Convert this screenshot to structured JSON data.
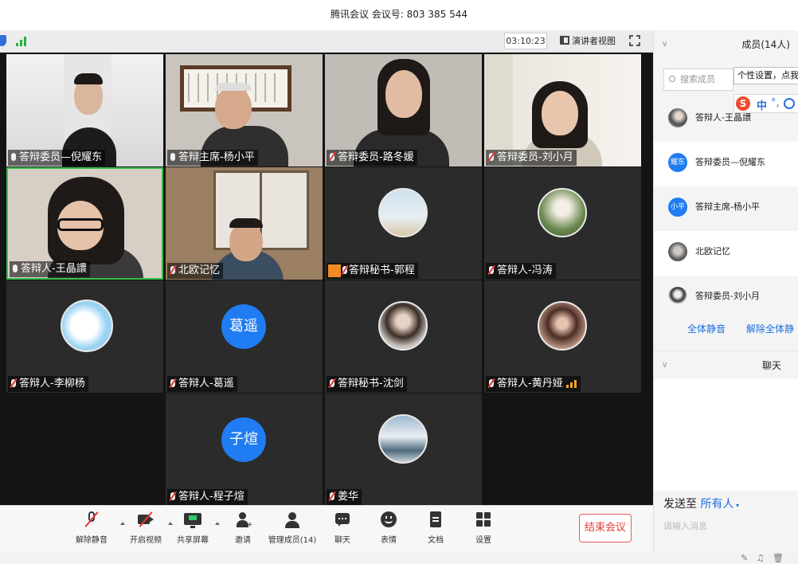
{
  "window_title": "腾讯会议 会议号: 803 385 544",
  "topbar": {
    "timer": "03:10:23",
    "speaker_view_label": "演讲者视图",
    "signal_color": "#27ae3e"
  },
  "tiles": [
    {
      "label": "答辩委员—倪耀东",
      "mic": "on",
      "type": "video"
    },
    {
      "label": "答辩主席-杨小平",
      "mic": "on",
      "type": "video"
    },
    {
      "label": "答辩委员-路冬媛",
      "mic": "muted",
      "type": "video"
    },
    {
      "label": "答辩委员-刘小月",
      "mic": "muted",
      "type": "video"
    },
    {
      "label": "答辩人-王晶譞",
      "mic": "on",
      "type": "video"
    },
    {
      "label": "北欧记忆",
      "mic": "muted",
      "type": "video"
    },
    {
      "label": "答辩秘书-郭程",
      "mic": "muted",
      "type": "avatar"
    },
    {
      "label": "答辩人-冯涛",
      "mic": "muted",
      "type": "avatar"
    },
    {
      "label": "答辩人-李柳杨",
      "mic": "muted",
      "type": "avatar"
    },
    {
      "label": "答辩人-葛遥",
      "mic": "muted",
      "type": "text-avatar",
      "avatar_text": "葛遥"
    },
    {
      "label": "答辩秘书-沈剑",
      "mic": "muted",
      "type": "avatar"
    },
    {
      "label": "答辩人-黄丹娅",
      "mic": "muted",
      "type": "avatar"
    },
    {
      "label": "答辩人-程子煊",
      "mic": "muted",
      "type": "text-avatar",
      "avatar_text": "子煊"
    },
    {
      "label": "姜华",
      "mic": "muted",
      "type": "avatar"
    }
  ],
  "toolbar": {
    "unmute": "解除静音",
    "start_video": "开启视频",
    "share_screen": "共享屏幕",
    "invite": "邀请",
    "manage_members": "管理成员(14)",
    "chat": "聊天",
    "reactions": "表情",
    "docs": "文档",
    "settings": "设置",
    "end_meeting": "结束会议"
  },
  "sidebar": {
    "members_title": "成员(14人)",
    "search_placeholder": "搜索成员",
    "tooltip": "个性设置，点我",
    "ime_zh": "中",
    "members": [
      {
        "name": "答辩人-王晶譞",
        "avatar": "photo"
      },
      {
        "name": "答辩委员—倪耀东",
        "avatar_text": "耀东"
      },
      {
        "name": "答辩主席-杨小平",
        "avatar_text": "小平"
      },
      {
        "name": "北欧记忆",
        "avatar": "photo"
      },
      {
        "name": "答辩委员-刘小月",
        "avatar": "photo"
      }
    ],
    "mute_all": "全体静音",
    "unmute_all": "解除全体静",
    "chat_title": "聊天",
    "send_to_label": "发送至",
    "send_to_target": "所有人",
    "chat_placeholder": "请输入消息"
  },
  "colors": {
    "accent": "#1f7cf3",
    "danger": "#e53935"
  }
}
